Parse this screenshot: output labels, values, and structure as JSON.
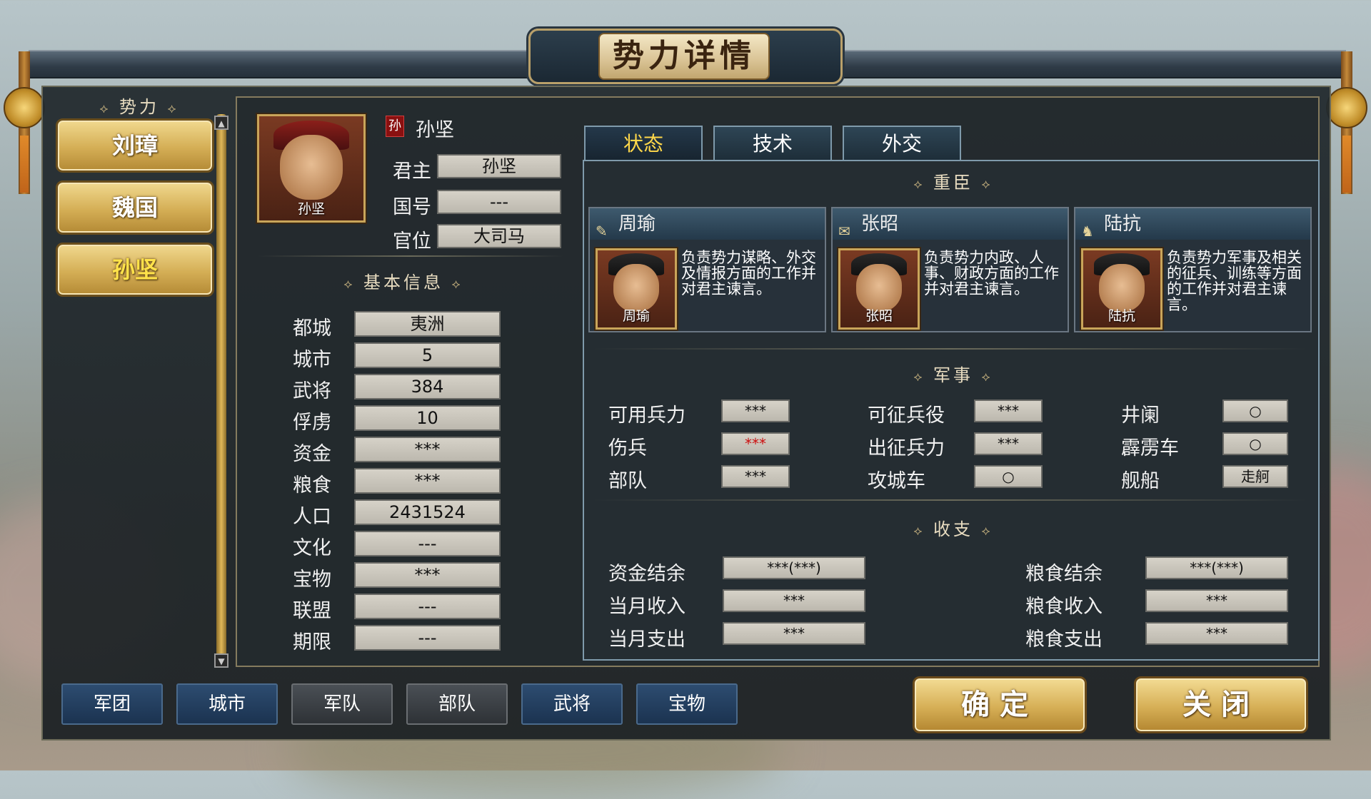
{
  "window_title": "势力详情",
  "sidebar": {
    "header": "势力",
    "factions": [
      {
        "label": "刘璋",
        "selected": false
      },
      {
        "label": "魏国",
        "selected": false
      },
      {
        "label": "孙坚",
        "selected": true
      }
    ]
  },
  "leader": {
    "portrait_name": "孙坚",
    "emblem": "孙",
    "faction_name": "孙坚",
    "fields": [
      {
        "label": "君主",
        "value": "孙坚"
      },
      {
        "label": "国号",
        "value": "---"
      },
      {
        "label": "官位",
        "value": "大司马"
      }
    ]
  },
  "basic_info": {
    "title": "基本信息",
    "rows": [
      {
        "label": "都城",
        "value": "夷洲"
      },
      {
        "label": "城市",
        "value": "5"
      },
      {
        "label": "武将",
        "value": "384"
      },
      {
        "label": "俘虏",
        "value": "10"
      },
      {
        "label": "资金",
        "value": "***"
      },
      {
        "label": "粮食",
        "value": "***"
      },
      {
        "label": "人口",
        "value": "2431524"
      },
      {
        "label": "文化",
        "value": "---"
      },
      {
        "label": "宝物",
        "value": "***"
      },
      {
        "label": "联盟",
        "value": "---"
      },
      {
        "label": "期限",
        "value": "---"
      }
    ]
  },
  "tabs": [
    {
      "label": "状态",
      "active": true
    },
    {
      "label": "技术",
      "active": false
    },
    {
      "label": "外交",
      "active": false
    }
  ],
  "ministers": {
    "title": "重臣",
    "items": [
      {
        "name": "周瑜",
        "icon": "feather-icon",
        "portrait_name": "周瑜",
        "desc": "负责势力谋略、外交及情报方面的工作并对君主谏言。"
      },
      {
        "name": "张昭",
        "icon": "scroll-icon",
        "portrait_name": "张昭",
        "desc": "负责势力内政、人事、财政方面的工作并对君主谏言。"
      },
      {
        "name": "陆抗",
        "icon": "horse-icon",
        "portrait_name": "陆抗",
        "desc": "负责势力军事及相关的征兵、训练等方面的工作并对君主谏言。"
      }
    ]
  },
  "military": {
    "title": "军事",
    "col1": [
      {
        "label": "可用兵力",
        "value": "***",
        "color": "#111111"
      },
      {
        "label": "伤兵",
        "value": "***",
        "color": "#cc1010"
      },
      {
        "label": "部队",
        "value": "***",
        "color": "#111111"
      }
    ],
    "col2": [
      {
        "label": "可征兵役",
        "value": "***"
      },
      {
        "label": "出征兵力",
        "value": "***"
      },
      {
        "label": "攻城车",
        "value": "○"
      }
    ],
    "col3": [
      {
        "label": "井阑",
        "value": "○"
      },
      {
        "label": "霹雳车",
        "value": "○"
      },
      {
        "label": "舰船",
        "value": "走舸"
      }
    ]
  },
  "finance": {
    "title": "收支",
    "left": [
      {
        "label": "资金结余",
        "value": "***(***)"
      },
      {
        "label": "当月收入",
        "value": "***"
      },
      {
        "label": "当月支出",
        "value": "***"
      }
    ],
    "right": [
      {
        "label": "粮食结余",
        "value": "***(***)"
      },
      {
        "label": "粮食收入",
        "value": "***"
      },
      {
        "label": "粮食支出",
        "value": "***"
      }
    ]
  },
  "bottom_tabs": [
    {
      "label": "军团",
      "style": "blue"
    },
    {
      "label": "城市",
      "style": "blue"
    },
    {
      "label": "军队",
      "style": "gray"
    },
    {
      "label": "部队",
      "style": "gray"
    },
    {
      "label": "武将",
      "style": "blue"
    },
    {
      "label": "宝物",
      "style": "blue"
    }
  ],
  "actions": {
    "confirm": "确定",
    "close": "关闭"
  },
  "colors": {
    "accent_gold": "#d4ae55",
    "active_tab_text": "#ffd84a",
    "panel": "#23292c"
  }
}
